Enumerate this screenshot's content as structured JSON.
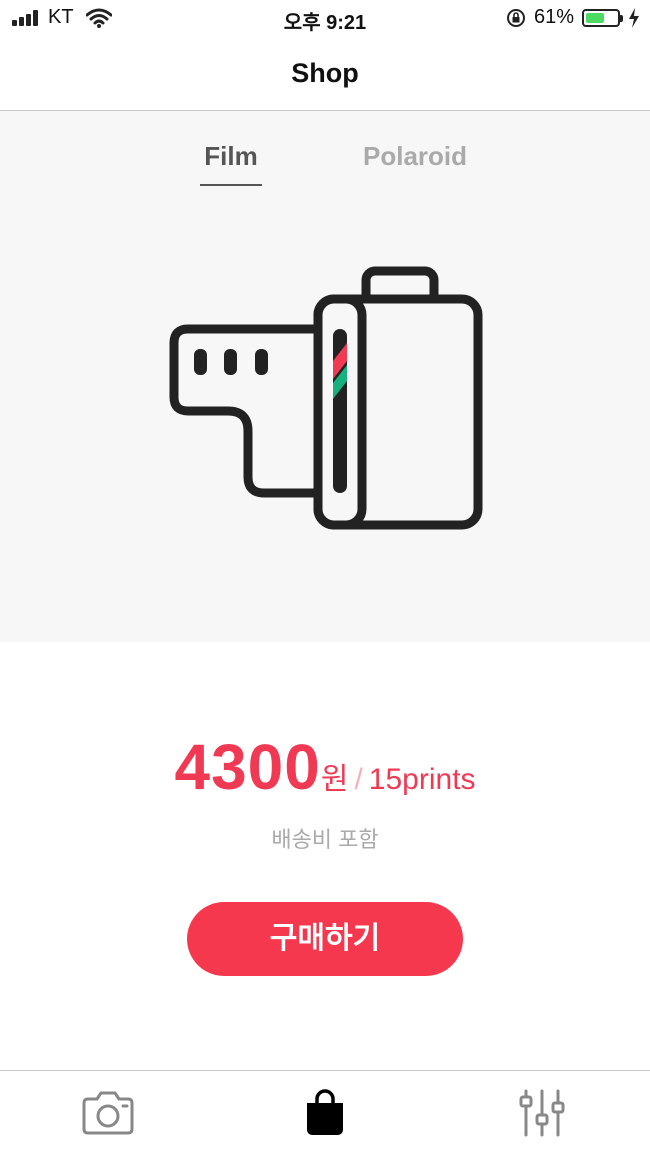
{
  "status_bar": {
    "carrier": "KT",
    "time": "오후 9:21",
    "battery_percent_text": "61%",
    "battery_level": 0.61,
    "battery_color": "#4cd964"
  },
  "nav": {
    "title": "Shop"
  },
  "tabs": [
    {
      "label": "Film",
      "selected": true
    },
    {
      "label": "Polaroid",
      "selected": false
    }
  ],
  "product": {
    "illustration": "film-canister-icon",
    "price": "4300",
    "currency": "원",
    "separator": "/",
    "quantity": "15prints",
    "shipping_note": "배송비 포함",
    "buy_label": "구매하기",
    "accent_color": "#f03a54"
  },
  "tabbar": [
    {
      "icon": "camera-icon",
      "active": false
    },
    {
      "icon": "shopping-bag-icon",
      "active": true
    },
    {
      "icon": "sliders-icon",
      "active": false
    }
  ]
}
